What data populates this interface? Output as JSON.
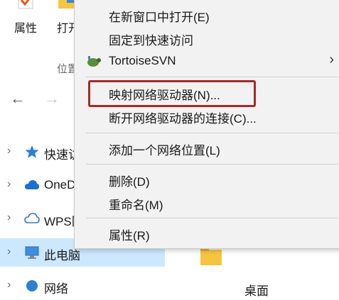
{
  "ribbon": {
    "properties_label": "属性",
    "open_label": "打开",
    "group_label": "位置"
  },
  "nav": {
    "back_icon": "←",
    "forward_icon": "→"
  },
  "tree": {
    "items": [
      {
        "label": "快速访问",
        "icon": "star-icon"
      },
      {
        "label": "OneDrive",
        "icon": "cloud-icon"
      },
      {
        "label": "WPS网盘",
        "icon": "cloud-outline-icon"
      },
      {
        "label": "此电脑",
        "icon": "computer-icon",
        "selected": true
      },
      {
        "label": "网络",
        "icon": "network-icon"
      }
    ],
    "chevron": "›"
  },
  "context_menu": {
    "items": [
      {
        "label": "在新窗口中打开(E)"
      },
      {
        "label": "固定到快速访问"
      },
      {
        "label": "TortoiseSVN",
        "icon": "tortoise-icon",
        "submenu": true
      },
      {
        "label": "映射网络驱动器(N)...",
        "highlighted": true
      },
      {
        "label": "断开网络驱动器的连接(C)..."
      },
      {
        "label": "添加一个网络位置(L)"
      },
      {
        "label": "删除(D)"
      },
      {
        "label": "重命名(M)"
      },
      {
        "label": "属性(R)"
      }
    ],
    "submenu_arrow": "›"
  },
  "right_pane": {
    "item_label": "桌面"
  },
  "colors": {
    "highlight_border": "#a52a2a",
    "selected_bg": "#cce8ff",
    "menu_bg": "#f2f2f2"
  }
}
